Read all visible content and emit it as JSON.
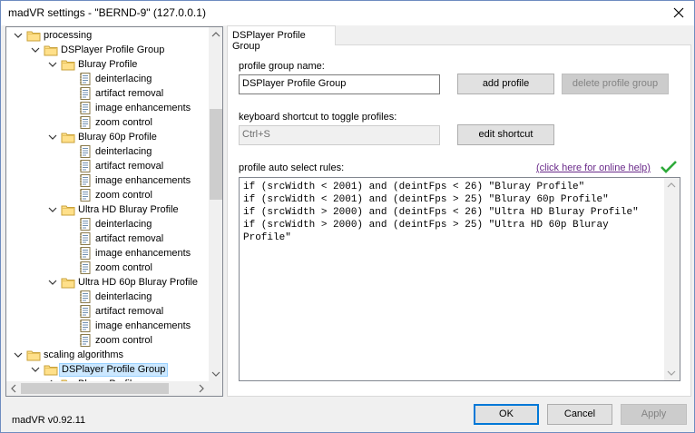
{
  "window": {
    "title": "madVR settings - \"BERND-9\" (127.0.0.1)"
  },
  "tree": {
    "items": [
      {
        "label": "processing",
        "level": 0,
        "type": "folder",
        "expanded": true
      },
      {
        "label": "DSPlayer Profile Group",
        "level": 1,
        "type": "folder",
        "expanded": true
      },
      {
        "label": "Bluray Profile",
        "level": 2,
        "type": "folder",
        "expanded": true
      },
      {
        "label": "deinterlacing",
        "level": 3,
        "type": "page"
      },
      {
        "label": "artifact removal",
        "level": 3,
        "type": "page"
      },
      {
        "label": "image enhancements",
        "level": 3,
        "type": "page"
      },
      {
        "label": "zoom control",
        "level": 3,
        "type": "page"
      },
      {
        "label": "Bluray 60p Profile",
        "level": 2,
        "type": "folder",
        "expanded": true
      },
      {
        "label": "deinterlacing",
        "level": 3,
        "type": "page"
      },
      {
        "label": "artifact removal",
        "level": 3,
        "type": "page"
      },
      {
        "label": "image enhancements",
        "level": 3,
        "type": "page"
      },
      {
        "label": "zoom control",
        "level": 3,
        "type": "page"
      },
      {
        "label": "Ultra HD Bluray Profile",
        "level": 2,
        "type": "folder",
        "expanded": true
      },
      {
        "label": "deinterlacing",
        "level": 3,
        "type": "page"
      },
      {
        "label": "artifact removal",
        "level": 3,
        "type": "page"
      },
      {
        "label": "image enhancements",
        "level": 3,
        "type": "page"
      },
      {
        "label": "zoom control",
        "level": 3,
        "type": "page"
      },
      {
        "label": "Ultra HD 60p Bluray Profile",
        "level": 2,
        "type": "folder",
        "expanded": true
      },
      {
        "label": "deinterlacing",
        "level": 3,
        "type": "page"
      },
      {
        "label": "artifact removal",
        "level": 3,
        "type": "page"
      },
      {
        "label": "image enhancements",
        "level": 3,
        "type": "page"
      },
      {
        "label": "zoom control",
        "level": 3,
        "type": "page"
      },
      {
        "label": "scaling algorithms",
        "level": 0,
        "type": "folder",
        "expanded": true
      },
      {
        "label": "DSPlayer Profile Group",
        "level": 1,
        "type": "folder",
        "expanded": true,
        "selected": true
      },
      {
        "label": "Bluray Profile",
        "level": 2,
        "type": "folder",
        "expanded": false
      }
    ]
  },
  "tab": {
    "label": "DSPlayer Profile Group"
  },
  "form": {
    "group_name_label": "profile group name:",
    "group_name_value": "DSPlayer Profile Group",
    "add_profile_label": "add profile",
    "delete_group_label": "delete profile group",
    "shortcut_label": "keyboard shortcut to toggle profiles:",
    "shortcut_value": "Ctrl+S",
    "edit_shortcut_label": "edit shortcut",
    "rules_label": "profile auto select rules:",
    "online_help_link": "(click here for online help)",
    "rules_text": "if (srcWidth < 2001) and (deintFps < 26) \"Bluray Profile\"\nif (srcWidth < 2001) and (deintFps > 25) \"Bluray 60p Profile\"\nif (srcWidth > 2000) and (deintFps < 26) \"Ultra HD Bluray Profile\"\nif (srcWidth > 2000) and (deintFps > 25) \"Ultra HD 60p Bluray Profile\""
  },
  "footer": {
    "version": "madVR v0.92.11",
    "ok_label": "OK",
    "cancel_label": "Cancel",
    "apply_label": "Apply"
  },
  "colors": {
    "selection": "#cce8ff",
    "link": "#6a2a8a",
    "check": "#2eaa3a",
    "default_button_border": "#0078d7"
  }
}
